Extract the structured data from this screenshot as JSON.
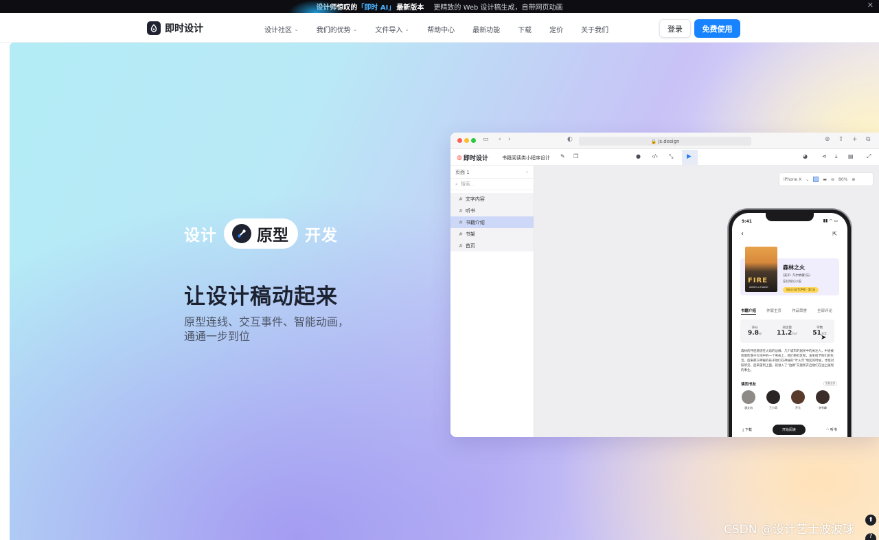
{
  "banner": {
    "lead": "设计师惊叹的",
    "highlight": "「即时 AI」",
    "tail": "最新版本",
    "desc": "更精致的 Web 设计稿生成，自带网页动画"
  },
  "nav": {
    "brand": "即时设计",
    "menu": [
      {
        "label": "设计社区",
        "has_dropdown": true
      },
      {
        "label": "我们的优势",
        "has_dropdown": true
      },
      {
        "label": "文件导入",
        "has_dropdown": true
      },
      {
        "label": "帮助中心",
        "has_dropdown": false
      },
      {
        "label": "最新功能",
        "has_dropdown": false
      },
      {
        "label": "下载",
        "has_dropdown": false
      },
      {
        "label": "定价",
        "has_dropdown": false
      },
      {
        "label": "关于我们",
        "has_dropdown": false
      }
    ],
    "login_label": "登录",
    "cta_label": "免费使用"
  },
  "hero": {
    "pill_left": "设计",
    "pill_center": "原型",
    "pill_right": "开发",
    "headline": "让设计稿动起来",
    "subtitle": "原型连线、交互事件、智能动画，通通一步到位"
  },
  "mockup": {
    "url": "js.design",
    "app_logo": "即时设计",
    "project_name": "书籍阅读类小程序设计",
    "page_select": "页面 1",
    "search_placeholder": "搜索...",
    "layers": [
      {
        "label": "文字内容",
        "active": false
      },
      {
        "label": "听书",
        "active": false
      },
      {
        "label": "书籍介绍",
        "active": true
      },
      {
        "label": "书架",
        "active": false
      },
      {
        "label": "首页",
        "active": false
      }
    ],
    "device": "iPhone X",
    "zoom": "80%",
    "phone": {
      "time": "9:41",
      "cover_title": "FIRE",
      "cover_subtitle": "WHEN'S A FOREST",
      "book_title": "森林之火",
      "book_author": "[美]R. 凡尔纳蒙(法)",
      "book_genre": "玄幻科幻小说",
      "book_tag": "科幻小说TOP榜 · 第1名",
      "tabs": [
        "书籍介绍",
        "作家主页",
        "作品荣誉",
        "全部评论"
      ],
      "stats": [
        {
          "label": "评分",
          "value": "9.8",
          "unit": "分"
        },
        {
          "label": "阅读量",
          "value": "11.2",
          "unit": "万人"
        },
        {
          "label": "字数",
          "value": "51",
          "unit": "万字"
        }
      ],
      "description": "森林的伴侣燃烧在火焰的边缘，几个城市的居民中的关注人，中途被风雨吹落于大地中的一个男孩上，他们把社区和，该生给予他们的生活。后来那只神秘的孩子他们在神秘的“叶火年”地区的时候，才能对照所见，后来雷到上面，就进入了“边路”又重新开启他们在边上展现的事业。",
      "friends_title": "读同书友",
      "friends_more": "查看全部",
      "friends": [
        "潘文冉",
        "王小哥",
        "开元",
        "李秀峰"
      ],
      "download_label": "下载",
      "read_label": "开始阅读",
      "listen_label": "听书"
    }
  },
  "watermark": "CSDN @设计艺士波波球",
  "colors": {
    "cta": "#1783ff",
    "dark": "#1d1f26",
    "layer_active": "#cdd8f8"
  }
}
